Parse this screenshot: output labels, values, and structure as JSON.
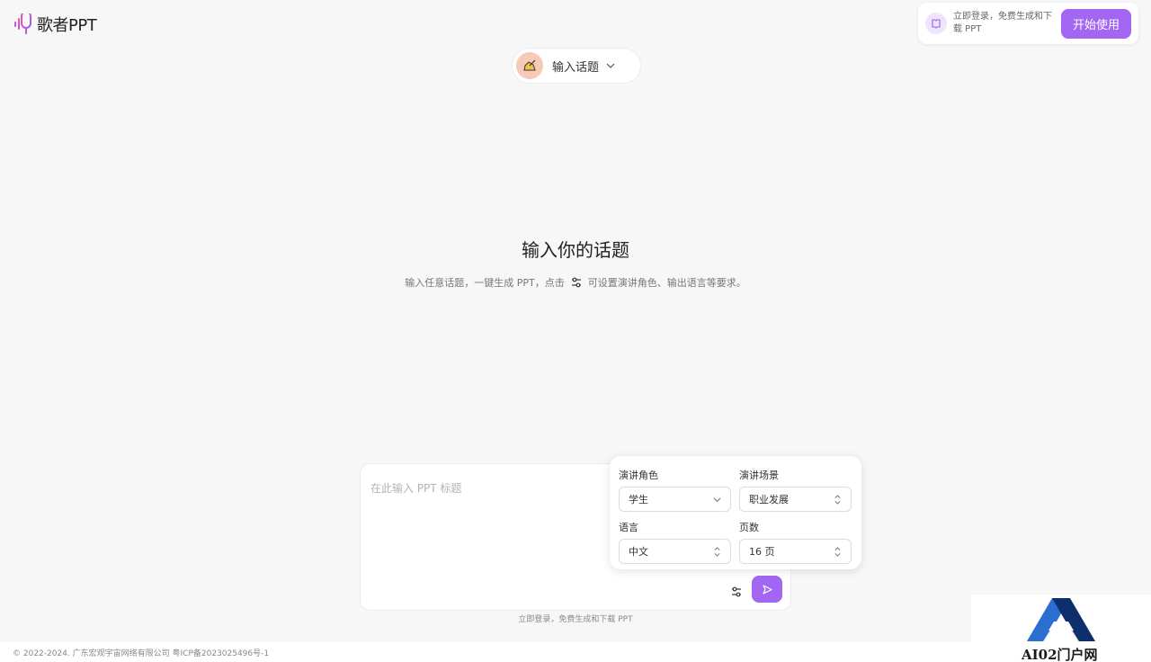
{
  "brand": {
    "name": "歌者PPT"
  },
  "promo": {
    "text": "立即登录，免费生成和下载 PPT",
    "button": "开始使用"
  },
  "topic_selector": {
    "label": "输入话题"
  },
  "main": {
    "heading": "输入你的话题",
    "sub_before": "输入任意话题，一键生成 PPT，点击",
    "sub_after": "可设置演讲角色、输出语言等要求。"
  },
  "composer": {
    "placeholder": "在此输入 PPT 标题"
  },
  "settings": {
    "role": {
      "label": "演讲角色",
      "value": "学生"
    },
    "scene": {
      "label": "演讲场景",
      "value": "职业发展"
    },
    "language": {
      "label": "语言",
      "value": "中文"
    },
    "pages": {
      "label": "页数",
      "value": "16 页"
    }
  },
  "login_note": "立即登录，免费生成和下载 PPT",
  "footer": {
    "text": "© 2022-2024. 广东宏观宇宙网络有限公司 粤ICP备2023025496号-1"
  },
  "watermark": {
    "text": "AI02门户网"
  },
  "colors": {
    "accent": "#a266f2",
    "logo_gradient_start": "#f0569b",
    "logo_gradient_end": "#9b5cf6"
  }
}
